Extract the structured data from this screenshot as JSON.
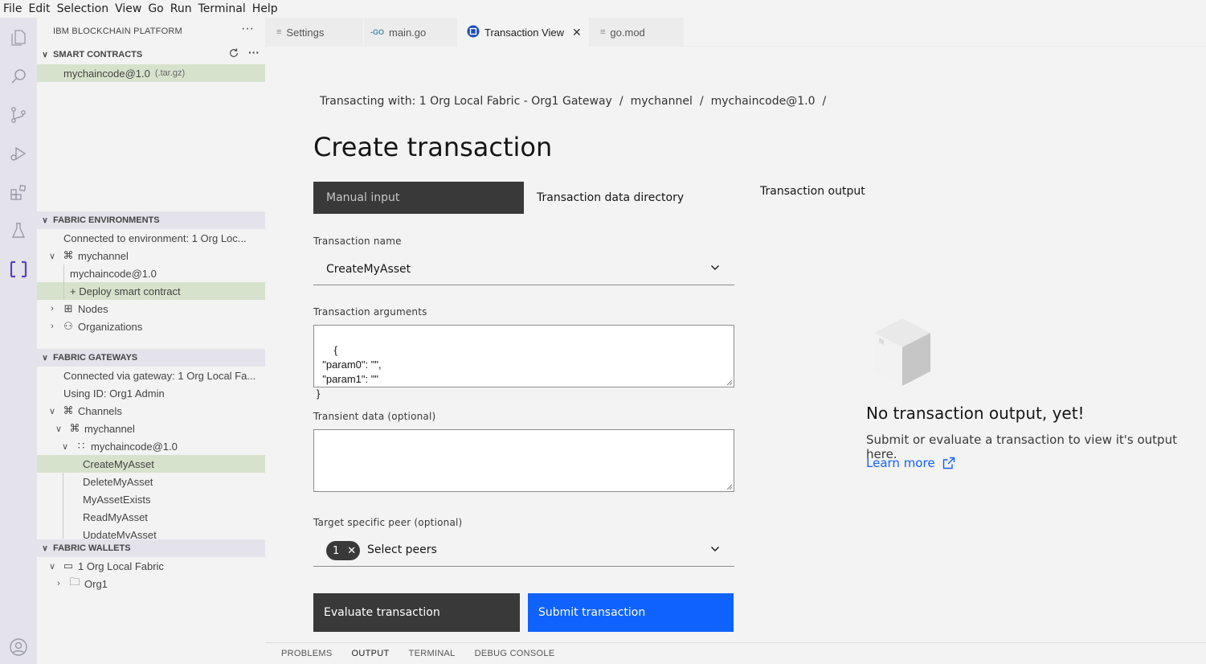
{
  "menu": [
    "File",
    "Edit",
    "Selection",
    "View",
    "Go",
    "Run",
    "Terminal",
    "Help"
  ],
  "activity_icons": [
    "explorer-icon",
    "search-icon",
    "source-control-icon",
    "run-debug-icon",
    "extensions-icon",
    "testing-icon",
    "blockchain-icon",
    "account-icon"
  ],
  "sidebar": {
    "title": "IBM BLOCKCHAIN PLATFORM",
    "more": "···",
    "smart_contracts": {
      "header": "SMART CONTRACTS",
      "items": [
        {
          "label": "mychaincode@1.0",
          "suffix": "(.tar.gz)"
        }
      ]
    },
    "fabric_environments": {
      "header": "FABRIC ENVIRONMENTS",
      "connected": "Connected to environment: 1 Org Loc...",
      "channel": "mychannel",
      "chaincode": "mychaincode@1.0",
      "deploy": "+ Deploy smart contract",
      "nodes": "Nodes",
      "organizations": "Organizations"
    },
    "fabric_gateways": {
      "header": "FABRIC GATEWAYS",
      "connected": "Connected via gateway: 1 Org Local Fa...",
      "identity": "Using ID: Org1 Admin",
      "channels": "Channels",
      "channel": "mychannel",
      "chaincode": "mychaincode@1.0",
      "transactions": [
        "CreateMyAsset",
        "DeleteMyAsset",
        "MyAssetExists",
        "ReadMyAsset",
        "UpdateMyAsset"
      ]
    },
    "fabric_wallets": {
      "header": "FABRIC WALLETS",
      "wallet": "1 Org Local Fabric",
      "org": "Org1"
    }
  },
  "tabs": [
    {
      "label": "Settings",
      "icon": "≡"
    },
    {
      "label": "main.go",
      "icon": "-GO"
    },
    {
      "label": "Transaction View",
      "icon": "blockchain"
    },
    {
      "label": "go.mod",
      "icon": "≡"
    }
  ],
  "main": {
    "breadcrumb": [
      "Transacting with: 1 Org Local Fabric - Org1 Gateway",
      "mychannel",
      "mychaincode@1.0"
    ],
    "breadcrumb_sep": "/",
    "title": "Create transaction",
    "switcher": [
      "Manual input",
      "Transaction data directory"
    ],
    "output_title": "Transaction output",
    "transaction_name_label": "Transaction name",
    "transaction_name_value": "CreateMyAsset",
    "arguments_label": "Transaction arguments",
    "arguments_value": "{\n  \"param0\": \"\",\n  \"param1\": \"\"\n}",
    "transient_label": "Transient data (optional)",
    "transient_value": "",
    "peer_label": "Target specific peer (optional)",
    "peer_count": "1",
    "peer_placeholder": "Select peers",
    "evaluate_button": "Evaluate transaction",
    "submit_button": "Submit transaction",
    "empty_title": "No transaction output, yet!",
    "empty_desc": "Submit or evaluate a transaction to view it's output here.",
    "learn_more": "Learn more"
  },
  "panel_tabs": [
    "PROBLEMS",
    "OUTPUT",
    "TERMINAL",
    "DEBUG CONSOLE"
  ],
  "colors": {
    "accent": "#0f62fe",
    "dark": "#393939",
    "selection": "#d7e2cc",
    "activity": "#e4e3ec",
    "blockchain_icon": "#5b3fbf"
  }
}
